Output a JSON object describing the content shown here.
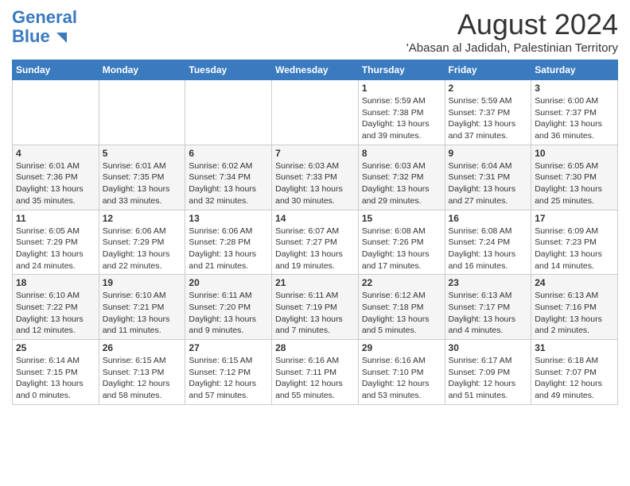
{
  "logo": {
    "line1": "General",
    "line2": "Blue"
  },
  "title": "August 2024",
  "subtitle": "'Abasan al Jadidah, Palestinian Territory",
  "days_of_week": [
    "Sunday",
    "Monday",
    "Tuesday",
    "Wednesday",
    "Thursday",
    "Friday",
    "Saturday"
  ],
  "weeks": [
    [
      {
        "day": "",
        "info": ""
      },
      {
        "day": "",
        "info": ""
      },
      {
        "day": "",
        "info": ""
      },
      {
        "day": "",
        "info": ""
      },
      {
        "day": "1",
        "info": "Sunrise: 5:59 AM\nSunset: 7:38 PM\nDaylight: 13 hours\nand 39 minutes."
      },
      {
        "day": "2",
        "info": "Sunrise: 5:59 AM\nSunset: 7:37 PM\nDaylight: 13 hours\nand 37 minutes."
      },
      {
        "day": "3",
        "info": "Sunrise: 6:00 AM\nSunset: 7:37 PM\nDaylight: 13 hours\nand 36 minutes."
      }
    ],
    [
      {
        "day": "4",
        "info": "Sunrise: 6:01 AM\nSunset: 7:36 PM\nDaylight: 13 hours\nand 35 minutes."
      },
      {
        "day": "5",
        "info": "Sunrise: 6:01 AM\nSunset: 7:35 PM\nDaylight: 13 hours\nand 33 minutes."
      },
      {
        "day": "6",
        "info": "Sunrise: 6:02 AM\nSunset: 7:34 PM\nDaylight: 13 hours\nand 32 minutes."
      },
      {
        "day": "7",
        "info": "Sunrise: 6:03 AM\nSunset: 7:33 PM\nDaylight: 13 hours\nand 30 minutes."
      },
      {
        "day": "8",
        "info": "Sunrise: 6:03 AM\nSunset: 7:32 PM\nDaylight: 13 hours\nand 29 minutes."
      },
      {
        "day": "9",
        "info": "Sunrise: 6:04 AM\nSunset: 7:31 PM\nDaylight: 13 hours\nand 27 minutes."
      },
      {
        "day": "10",
        "info": "Sunrise: 6:05 AM\nSunset: 7:30 PM\nDaylight: 13 hours\nand 25 minutes."
      }
    ],
    [
      {
        "day": "11",
        "info": "Sunrise: 6:05 AM\nSunset: 7:29 PM\nDaylight: 13 hours\nand 24 minutes."
      },
      {
        "day": "12",
        "info": "Sunrise: 6:06 AM\nSunset: 7:29 PM\nDaylight: 13 hours\nand 22 minutes."
      },
      {
        "day": "13",
        "info": "Sunrise: 6:06 AM\nSunset: 7:28 PM\nDaylight: 13 hours\nand 21 minutes."
      },
      {
        "day": "14",
        "info": "Sunrise: 6:07 AM\nSunset: 7:27 PM\nDaylight: 13 hours\nand 19 minutes."
      },
      {
        "day": "15",
        "info": "Sunrise: 6:08 AM\nSunset: 7:26 PM\nDaylight: 13 hours\nand 17 minutes."
      },
      {
        "day": "16",
        "info": "Sunrise: 6:08 AM\nSunset: 7:24 PM\nDaylight: 13 hours\nand 16 minutes."
      },
      {
        "day": "17",
        "info": "Sunrise: 6:09 AM\nSunset: 7:23 PM\nDaylight: 13 hours\nand 14 minutes."
      }
    ],
    [
      {
        "day": "18",
        "info": "Sunrise: 6:10 AM\nSunset: 7:22 PM\nDaylight: 13 hours\nand 12 minutes."
      },
      {
        "day": "19",
        "info": "Sunrise: 6:10 AM\nSunset: 7:21 PM\nDaylight: 13 hours\nand 11 minutes."
      },
      {
        "day": "20",
        "info": "Sunrise: 6:11 AM\nSunset: 7:20 PM\nDaylight: 13 hours\nand 9 minutes."
      },
      {
        "day": "21",
        "info": "Sunrise: 6:11 AM\nSunset: 7:19 PM\nDaylight: 13 hours\nand 7 minutes."
      },
      {
        "day": "22",
        "info": "Sunrise: 6:12 AM\nSunset: 7:18 PM\nDaylight: 13 hours\nand 5 minutes."
      },
      {
        "day": "23",
        "info": "Sunrise: 6:13 AM\nSunset: 7:17 PM\nDaylight: 13 hours\nand 4 minutes."
      },
      {
        "day": "24",
        "info": "Sunrise: 6:13 AM\nSunset: 7:16 PM\nDaylight: 13 hours\nand 2 minutes."
      }
    ],
    [
      {
        "day": "25",
        "info": "Sunrise: 6:14 AM\nSunset: 7:15 PM\nDaylight: 13 hours\nand 0 minutes."
      },
      {
        "day": "26",
        "info": "Sunrise: 6:15 AM\nSunset: 7:13 PM\nDaylight: 12 hours\nand 58 minutes."
      },
      {
        "day": "27",
        "info": "Sunrise: 6:15 AM\nSunset: 7:12 PM\nDaylight: 12 hours\nand 57 minutes."
      },
      {
        "day": "28",
        "info": "Sunrise: 6:16 AM\nSunset: 7:11 PM\nDaylight: 12 hours\nand 55 minutes."
      },
      {
        "day": "29",
        "info": "Sunrise: 6:16 AM\nSunset: 7:10 PM\nDaylight: 12 hours\nand 53 minutes."
      },
      {
        "day": "30",
        "info": "Sunrise: 6:17 AM\nSunset: 7:09 PM\nDaylight: 12 hours\nand 51 minutes."
      },
      {
        "day": "31",
        "info": "Sunrise: 6:18 AM\nSunset: 7:07 PM\nDaylight: 12 hours\nand 49 minutes."
      }
    ]
  ]
}
